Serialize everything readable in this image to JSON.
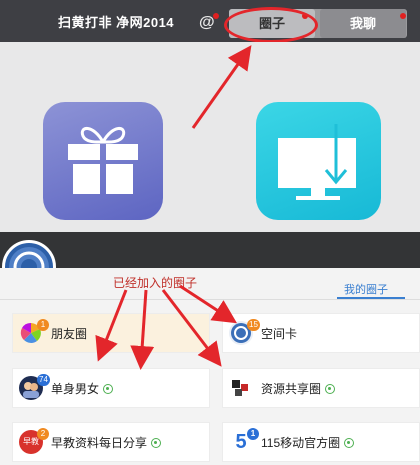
{
  "header": {
    "title": "扫黄打非 净网2014",
    "at_symbol": "@",
    "tabs": [
      {
        "label": "圈子",
        "selected": true
      },
      {
        "label": "我聊",
        "selected": false
      }
    ]
  },
  "annotation": "已经加入的圈子",
  "panel": {
    "tab_label": "我的圈子"
  },
  "circles": [
    {
      "name": "朋友圈",
      "badge": "1",
      "highlight": true,
      "verified": false,
      "icon": "pinwheel-icon"
    },
    {
      "name": "空间卡",
      "badge": "15",
      "highlight": false,
      "verified": false,
      "icon": "ring-icon"
    },
    {
      "name": "单身男女",
      "badge": "74",
      "highlight": false,
      "verified": true,
      "icon": "couple-icon"
    },
    {
      "name": "资源共享圈",
      "badge": "",
      "highlight": false,
      "verified": true,
      "icon": "cubes-icon"
    },
    {
      "name": "早教资料每日分享",
      "badge": "2",
      "highlight": false,
      "verified": true,
      "icon": "early-edu-icon",
      "icon_text": "早教"
    },
    {
      "name": "115移动官方圈",
      "badge": "1",
      "highlight": false,
      "verified": true,
      "icon": "115-logo-icon",
      "icon_text": "5"
    }
  ],
  "colors": {
    "header_bg": "#3e3f44",
    "annotation_red": "#e3262b",
    "accent_blue": "#3a7fd0",
    "highlight_bg": "#fbf1de"
  }
}
